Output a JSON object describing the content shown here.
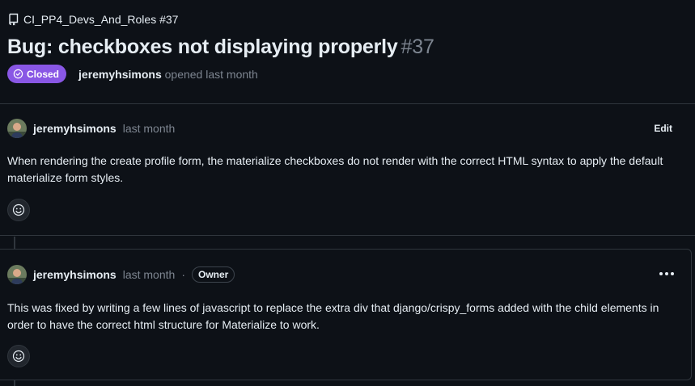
{
  "header": {
    "repo_ref": "CI_PP4_Devs_And_Roles #37",
    "title": "Bug: checkboxes not displaying properly",
    "number": "#37",
    "state": "Closed",
    "author": "jeremyhsimons",
    "opened_text": "opened last month"
  },
  "comments": [
    {
      "user": "jeremyhsimons",
      "time": "last month",
      "action_label": "Edit",
      "body": "When rendering the create profile form, the materialize checkboxes do not render with the correct HTML syntax to apply the default materialize form styles."
    },
    {
      "user": "jeremyhsimons",
      "time": "last month",
      "separator": "·",
      "role_badge": "Owner",
      "body": "This was fixed by writing a few lines of javascript to replace the extra div that django/crispy_forms added with the child elements in order to have the correct html structure for Materialize to work."
    }
  ],
  "colors": {
    "background": "#0d1117",
    "closed_badge": "#8957e5",
    "muted_text": "#7d8590",
    "border": "#30363d"
  },
  "icons": [
    "repo-icon",
    "issue-closed-icon",
    "avatar",
    "smiley-icon",
    "kebab-menu-icon"
  ]
}
